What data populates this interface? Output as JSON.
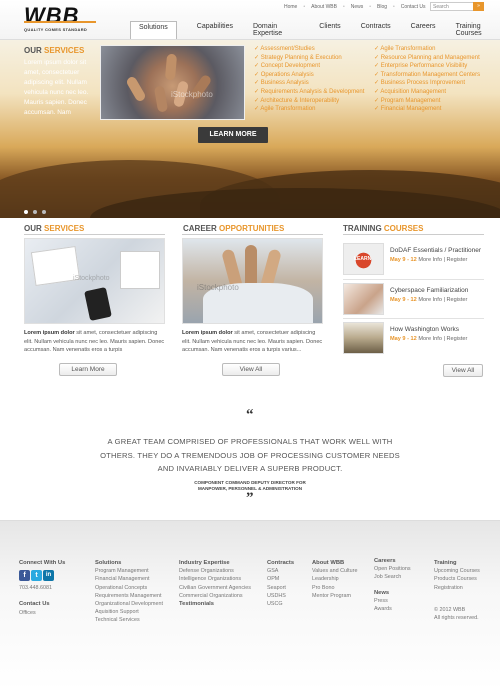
{
  "header": {
    "logo_text": "WBB",
    "tagline": "QUALITY COMES STANDARD",
    "util_links": [
      "Home",
      "About WBB",
      "News",
      "Blog",
      "Contact Us"
    ],
    "search_placeholder": "Search",
    "search_button": "»",
    "nav": [
      "Solutions",
      "Capabilities",
      "Domain Expertise",
      "Clients",
      "Contracts",
      "Careers",
      "Training Courses"
    ],
    "active_nav": "Solutions"
  },
  "hero": {
    "heading_a": "OUR",
    "heading_b": "SERVICES",
    "intro": "Lorem ipsum dolor sit amet, consectetuer adipiscing elit. Nullam vehicula nunc nec leo. Mauris sapien. Donec accumsan. Nam",
    "services_left": [
      "Assessment/Studies",
      "Strategy Planning & Execution",
      "Concept Development",
      "Operations Analysis",
      "Business Analysis",
      "Requirements Analysis & Development",
      "Architecture & Interoperability",
      "Agile Transformation"
    ],
    "services_right": [
      "Agile Transformation",
      "Resource Planning and Management",
      "Enterprise Performance Visibility",
      "Transformation Management Centers",
      "Business Process Improvement",
      "Acquisition Management",
      "Program Management",
      "Financial Management"
    ],
    "cta": "LEARN MORE",
    "watermark": "iStockphoto"
  },
  "columns": {
    "services": {
      "heading_a": "OUR",
      "heading_b": "SERVICES",
      "lead": "Lorem ipsum dolor",
      "text": " sit amet, consectetuer adipiscing elit. Nullam vehicula nunc nec leo. Mauris sapien. Donec accumsan. Nam venenatis eros a turpis",
      "button": "Learn More"
    },
    "career": {
      "heading_a": "CAREER",
      "heading_b": "OPPORTUNITIES",
      "lead": "Lorem ipsum dolor",
      "text": " sit amet, consectetuer adipiscing elit. Nullam vehicula nunc nec leo. Mauris sapien. Donec accumsan. Nam venenatis eros a turpis varius...",
      "button": "View All"
    },
    "training": {
      "heading_a": "TRAINING",
      "heading_b": "COURSES",
      "courses": [
        {
          "title": "DoDAF Essentials / Practitioner",
          "date": "May 9 - 12",
          "more": "More Info",
          "register": "Register"
        },
        {
          "title": "Cyberspace Familiarization",
          "date": "May 9 - 12",
          "more": "More Info",
          "register": "Register"
        },
        {
          "title": "How Washington Works",
          "date": "May 9 - 12",
          "more": "More Info",
          "register": "Register"
        }
      ],
      "button": "View All"
    }
  },
  "quote": {
    "open": "“",
    "text": "A GREAT TEAM COMPRISED OF PROFESSIONALS THAT WORK WELL WITH OTHERS. THEY DO A TREMENDOUS JOB OF PROCESSING CUSTOMER NEEDS AND INVARIABLY DELIVER A SUPERB PRODUCT.",
    "source_1": "COMPONENT COMMAND DEPUTY DIRECTOR FOR",
    "source_2": "MANPOWER, PERSONNEL & ADMINISTRATION",
    "close": "”"
  },
  "footer": {
    "connect": "Connect With Us",
    "social": [
      "f",
      "t",
      "in"
    ],
    "social_colors": [
      "#3b5998",
      "#2aa9e0",
      "#0e76a8"
    ],
    "phone": "703.448.6081",
    "contact_heading": "Contact Us",
    "offices": "Offices",
    "solutions": {
      "heading": "Solutions",
      "items": [
        "Program Management",
        "Financial Management",
        "Operational Concepts",
        "Requirements Management",
        "Organizational Development",
        "Aquisition Support",
        "Technical Services"
      ]
    },
    "industry": {
      "heading": "Industry Expertise",
      "items": [
        "Defense Organizations",
        "Intelligence Organizations",
        "Civilian Government Agencies",
        "Commercial Organizations"
      ],
      "extra": "Testimonials"
    },
    "contracts": {
      "heading": "Contracts",
      "items": [
        "GSA",
        "OPM",
        "Seaport",
        "USDHS",
        "USCG"
      ]
    },
    "about": {
      "heading": "About WBB",
      "items": [
        "Values and Culture",
        "Leadership",
        "Pro Bono",
        "Mentor Program"
      ]
    },
    "careers": {
      "heading": "Careers",
      "items": [
        "Open Positions",
        "Job Search"
      ]
    },
    "news": {
      "heading": "News",
      "items": [
        "Press",
        "Awards"
      ]
    },
    "training": {
      "heading": "Training",
      "items": [
        "Upcoming Courses",
        "Products Courses",
        "Registration"
      ]
    },
    "copyright": "© 2012 WBB",
    "rights": "All rights reserved."
  }
}
